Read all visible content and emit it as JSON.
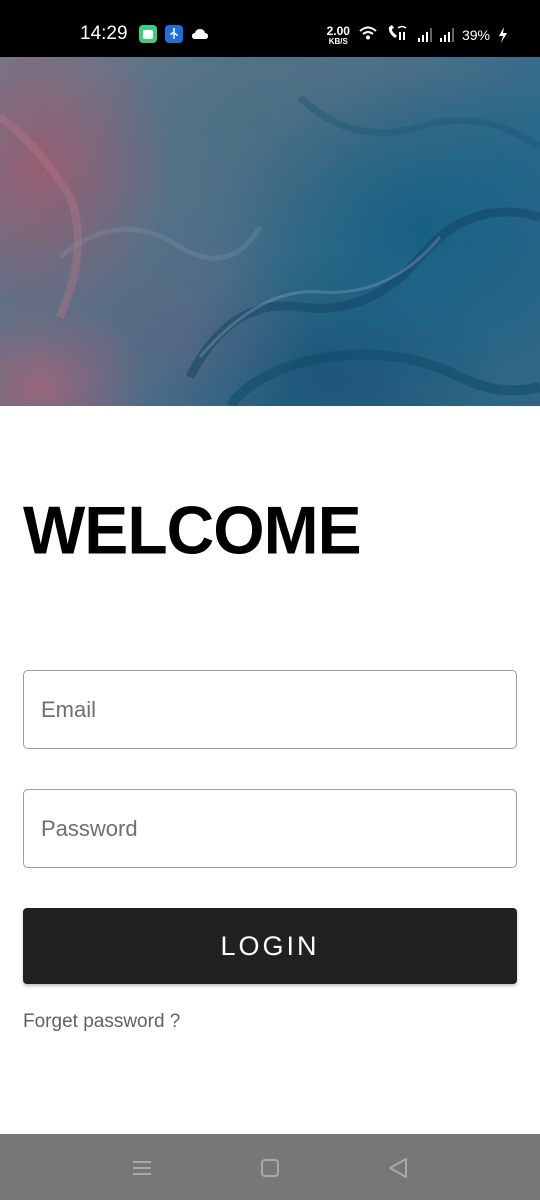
{
  "status_bar": {
    "time": "14:29",
    "net_speed_value": "2.00",
    "net_speed_unit": "KB/S",
    "battery": "39%",
    "icons": [
      "chat-app-icon",
      "usb-debug-icon",
      "cloud-icon",
      "wifi-icon",
      "volte-call-icon",
      "signal-sim1-icon",
      "signal-sim2-icon",
      "charging-bolt-icon"
    ]
  },
  "hero": {
    "image": "abstract-marble-texture",
    "colors": [
      "#a0607a",
      "#4d6f86",
      "#145f82"
    ]
  },
  "login": {
    "title": "WELCOME",
    "email_placeholder": "Email",
    "email_value": "",
    "password_placeholder": "Password",
    "password_value": "",
    "login_label": "LOGIN",
    "forgot_label": "Forget password ?"
  },
  "nav_bar": {
    "buttons": [
      "menu-icon",
      "home-icon",
      "back-icon"
    ]
  },
  "colors": {
    "button_bg": "#212121",
    "nav_bg": "#777777",
    "status_bg": "#000000"
  }
}
